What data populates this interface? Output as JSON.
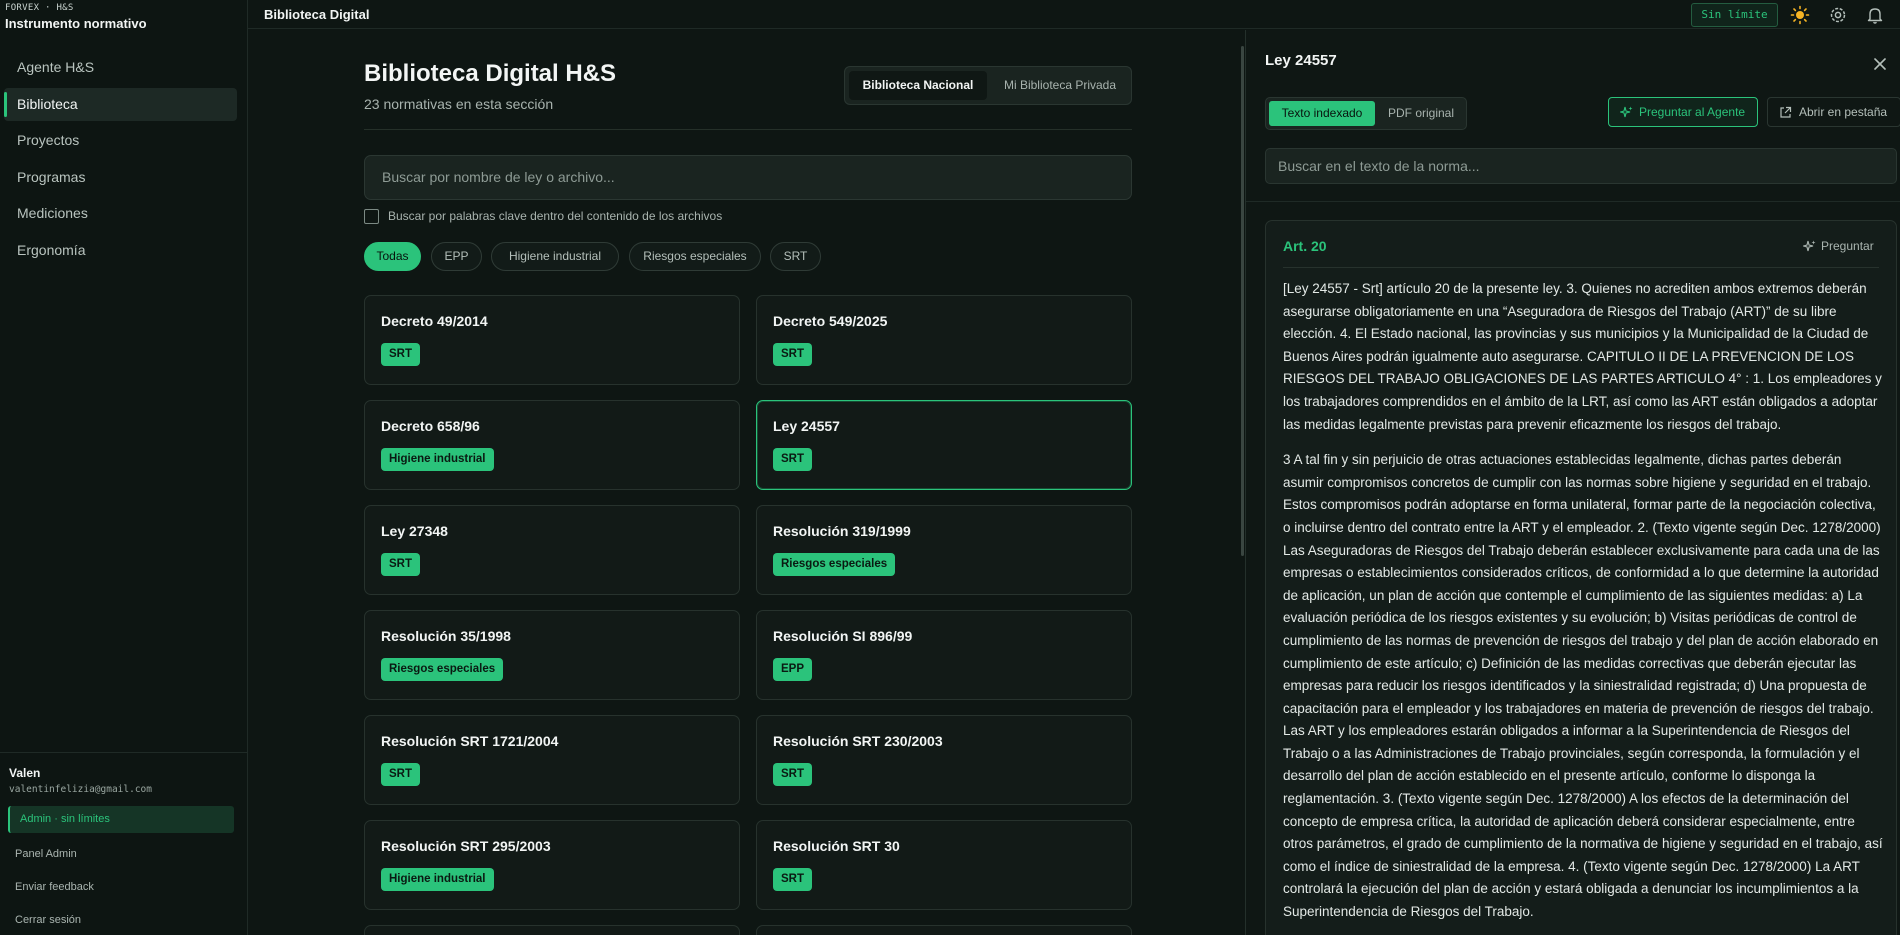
{
  "brand": {
    "top": "FORVEX · H&S",
    "title": "Instrumento normativo"
  },
  "nav": [
    {
      "label": "Agente H&S",
      "active": false
    },
    {
      "label": "Biblioteca",
      "active": true
    },
    {
      "label": "Proyectos",
      "active": false
    },
    {
      "label": "Programas",
      "active": false
    },
    {
      "label": "Mediciones",
      "active": false
    },
    {
      "label": "Ergonomía",
      "active": false
    }
  ],
  "user": {
    "name": "Valen",
    "email": "valentinfelizia@gmail.com",
    "badge": "Admin · sin límites",
    "links": [
      "Panel Admin",
      "Enviar feedback",
      "Cerrar sesión"
    ]
  },
  "topbar": {
    "title": "Biblioteca Digital",
    "plan": "Sin límite"
  },
  "main": {
    "title": "Biblioteca Digital H&S",
    "subtitle": "23 normativas en esta sección",
    "tabs": [
      "Biblioteca Nacional",
      "Mi Biblioteca Privada"
    ],
    "search_placeholder": "Buscar por nombre de ley o archivo...",
    "keyword_label": "Buscar por palabras clave dentro del contenido de los archivos",
    "filters": [
      "Todas",
      "EPP",
      "Higiene industrial",
      "Riesgos especiales",
      "SRT"
    ],
    "cards": [
      {
        "title": "Decreto 49/2014",
        "tag": "SRT"
      },
      {
        "title": "Decreto 549/2025",
        "tag": "SRT"
      },
      {
        "title": "Decreto 658/96",
        "tag": "Higiene industrial"
      },
      {
        "title": "Ley 24557",
        "tag": "SRT"
      },
      {
        "title": "Ley 27348",
        "tag": "SRT"
      },
      {
        "title": "Resolución 319/1999",
        "tag": "Riesgos especiales"
      },
      {
        "title": "Resolución 35/1998",
        "tag": "Riesgos especiales"
      },
      {
        "title": "Resolución SI 896/99",
        "tag": "EPP"
      },
      {
        "title": "Resolución SRT 1721/2004",
        "tag": "SRT"
      },
      {
        "title": "Resolución SRT 230/2003",
        "tag": "SRT"
      },
      {
        "title": "Resolución SRT 295/2003",
        "tag": "Higiene industrial"
      },
      {
        "title": "Resolución SRT 30",
        "tag": "SRT"
      }
    ]
  },
  "panel": {
    "title": "Ley 24557",
    "view_tabs": [
      "Texto indexado",
      "PDF original"
    ],
    "ask_label": "Preguntar al Agente",
    "open_label": "Abrir en pestaña",
    "search_placeholder": "Buscar en el texto de la norma...",
    "article": {
      "header": "Art. 20",
      "ask": "Preguntar",
      "paragraphs": [
        "[Ley 24557 - Srt] artículo 20 de la presente ley. 3. Quienes no acrediten ambos extremos deberán asegurarse obligatoriamente en una “Aseguradora de Riesgos del Trabajo (ART)” de su libre elección. 4. El Estado nacional, las provincias y sus municipios y la Municipalidad de la Ciudad de Buenos Aires podrán igualmente auto asegurarse. CAPITULO II DE LA PREVENCION DE LOS RIESGOS DEL TRABAJO OBLIGACIONES DE LAS PARTES ARTICULO 4° : 1. Los empleadores y los trabajadores comprendidos en el ámbito de la LRT, así como las ART están obligados a adoptar las medidas legalmente previstas para prevenir eficazmente los riesgos del trabajo.",
        "3 A tal fin y sin perjuicio de otras actuaciones establecidas legalmente, dichas partes deberán asumir compromisos concretos de cumplir con las normas sobre higiene y seguridad en el trabajo. Estos compromisos podrán adoptarse en forma unilateral, formar parte de la negociación colectiva, o incluirse dentro del contrato entre la ART y el empleador. 2. (Texto vigente según Dec. 1278/2000) Las Aseguradoras de Riesgos del Trabajo deberán establecer exclusivamente para cada una de las empresas o establecimientos considerados críticos, de conformidad a lo que determine la autoridad de aplicación, un plan de acción que contemple el cumplimiento de las siguientes medidas: a) La evaluación periódica de los riesgos existentes y su evolución; b) Visitas periódicas de control de cumplimiento de las normas de prevención de riesgos del trabajo y del plan de acción elaborado en cumplimiento de este artículo; c) Definición de las medidas correctivas que deberán ejecutar las empresas para reducir los riesgos identificados y la siniestralidad registrada; d) Una propuesta de capacitación para el empleador y los trabajadores en materia de prevención de riesgos del trabajo. Las ART y los empleadores estarán obligados a informar a la Superintendencia de Riesgos del Trabajo o a las Administraciones de Trabajo provinciales, según corresponda, la formulación y el desarrollo del plan de acción establecido en el presente artículo, conforme lo disponga la reglamentación. 3. (Texto vigente según Dec. 1278/2000) A los efectos de la determinación del concepto de empresa crítica, la autoridad de aplicación deberá considerar especialmente, entre otros parámetros, el grado de cumplimiento de la normativa de higiene y seguridad en el trabajo, así como el índice de siniestralidad de la empresa. 4. (Texto vigente según Dec. 1278/2000) La ART controlará la ejecución del plan de acción y estará obligada a denunciar los incumplimientos a la Superintendencia de Riesgos del Trabajo."
      ]
    }
  },
  "colors": {
    "accent": "#2bc37b",
    "background": "#0e1613"
  },
  "icons": [
    "sun-icon",
    "gear-icon",
    "bell-icon",
    "close-icon",
    "sparkle-icon",
    "external-link-icon"
  ]
}
